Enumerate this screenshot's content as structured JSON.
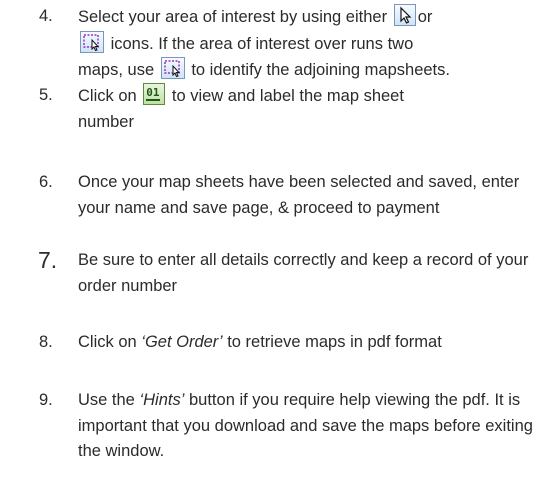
{
  "steps": [
    {
      "num": "4.",
      "text_a": "Select your area of interest by using either",
      "text_b": "or",
      "text_c": "icons. If the area of interest over runs two",
      "text_d": "maps, use",
      "text_e": "to identify the adjoining mapsheets."
    },
    {
      "num": "5.",
      "text_a": "Click on",
      "text_b": "to view and label the map sheet",
      "text_c": "number"
    },
    {
      "num": "6.",
      "text": "Once your map sheets have been selected and saved, enter your name and save page, & proceed to payment"
    },
    {
      "num": "7.",
      "text": "Be sure to enter all details correctly and keep a record of  your order number"
    },
    {
      "num": "8.",
      "text_a": "Click on",
      "emph": "‘Get Order’",
      "text_b": "to retrieve maps in pdf format"
    },
    {
      "num": "9.",
      "text_a": "Use the",
      "emph": "‘Hints’",
      "text_b": "button if you require help viewing the pdf. It is important that you download and save the maps before exiting the window."
    }
  ],
  "icons": {
    "pointer": "pointer-select-icon",
    "box_select": "box-select-icon",
    "mapsheet": "mapsheet-number-icon",
    "mapsheet_label": "01"
  }
}
